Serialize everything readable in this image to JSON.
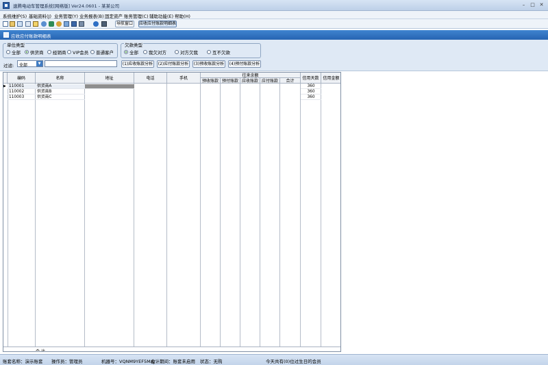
{
  "window": {
    "title": "速腾电动车管理系统[网络版] Ver24.0601 - 某某公司",
    "controls": [
      "–",
      "□",
      "✕"
    ]
  },
  "menubar": [
    "系统维护(S)",
    "基础资料(J)",
    "业务管理(Y)",
    "业务报表(B)",
    "固定资产",
    "账务管理(C)",
    "辅助功能(E)",
    "帮助(H)"
  ],
  "toolbar": {
    "icons": [
      "new-icon",
      "open-icon",
      "copy-icon",
      "list-icon",
      "edit-icon",
      "user-icon",
      "wrench-icon",
      "search-icon",
      "card-icon",
      "save-icon",
      "print-icon",
      "help-icon",
      "exit-icon"
    ],
    "nav_button": "导航窗口",
    "active_tab": "应收应付账款明细表"
  },
  "page": {
    "title": "应收应付账款明细表"
  },
  "filters": {
    "unit_type": {
      "label": "单位类型",
      "options": [
        "全部",
        "供货商",
        "经销商",
        "VIP会员",
        "普通客户"
      ],
      "selected": "供货商"
    },
    "debt_type": {
      "label": "欠款类型",
      "options": [
        "全部",
        "我欠对方",
        "对方欠我",
        "互不欠款"
      ],
      "selected": "全部"
    },
    "filter": {
      "label": "过滤:",
      "select_value": "全部",
      "input_value": ""
    },
    "analysis_buttons": [
      "(1)应收账款分析",
      "(2)应付账款分析",
      "(3)预收账款分析",
      "(4)预付账款分析"
    ]
  },
  "table": {
    "columns": [
      "编码",
      "名称",
      "地址",
      "电话",
      "手机",
      "往来余额",
      "信用天数",
      "信用金额"
    ],
    "subcolumns": [
      "预收账款",
      "预付账款",
      "应收账款",
      "应付账款",
      "合计"
    ],
    "rows": [
      {
        "code": "110001",
        "name": "供货商A",
        "credit_days": "360"
      },
      {
        "code": "110002",
        "name": "供货商B",
        "credit_days": "360"
      },
      {
        "code": "110003",
        "name": "供货商C",
        "credit_days": "360"
      }
    ],
    "footer_label": "合 计"
  },
  "statusbar": {
    "account": "账套名称：演示账套",
    "operator": "操作员：管理员",
    "machine": "机器号：VQNM9YEF5MAJ",
    "period": "会计期间：账套未启用",
    "status": "状态：无购",
    "notice": "今天共有(0)位过生日的会员"
  }
}
